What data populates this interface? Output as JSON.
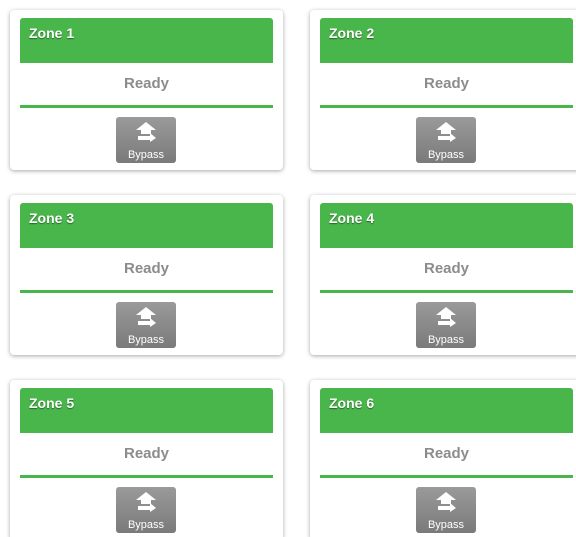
{
  "zones": [
    {
      "name": "Zone 1",
      "status": "Ready",
      "button_label": "Bypass",
      "icon": "bypass-arrow-icon"
    },
    {
      "name": "Zone 2",
      "status": "Ready",
      "button_label": "Bypass",
      "icon": "bypass-arrow-icon"
    },
    {
      "name": "Zone 3",
      "status": "Ready",
      "button_label": "Bypass",
      "icon": "bypass-arrow-icon"
    },
    {
      "name": "Zone 4",
      "status": "Ready",
      "button_label": "Bypass",
      "icon": "bypass-arrow-icon"
    },
    {
      "name": "Zone 5",
      "status": "Ready",
      "button_label": "Bypass",
      "icon": "bypass-arrow-icon"
    },
    {
      "name": "Zone 6",
      "status": "Ready",
      "button_label": "Bypass",
      "icon": "bypass-arrow-icon"
    }
  ],
  "colors": {
    "ready_green": "#48b64a",
    "status_text": "#8c8c8c",
    "button_gray": "#8a8a8a"
  }
}
